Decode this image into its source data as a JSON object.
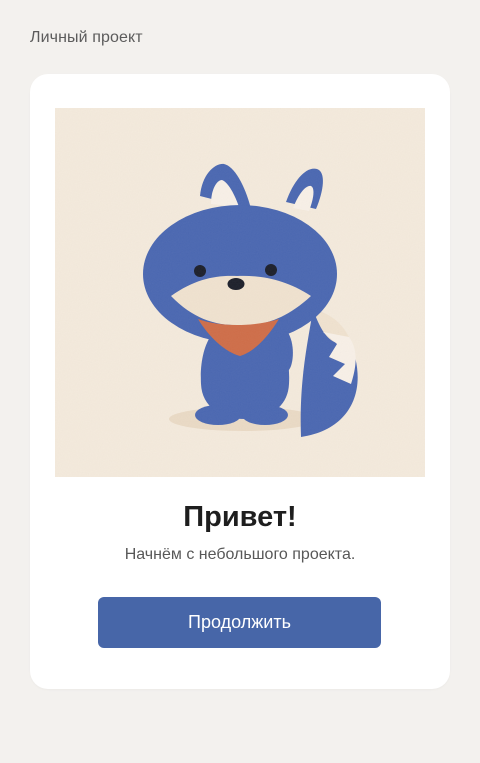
{
  "header": {
    "project_label": "Личный проект"
  },
  "card": {
    "title": "Привет!",
    "subtitle": "Начнём с небольшого проекта.",
    "continue_label": "Продолжить"
  },
  "illustration": {
    "subject": "fox-mascot",
    "colors": {
      "background": "#f4eadc",
      "fur": "#4a67b1",
      "muzzle": "#f0e2cf",
      "scarf": "#cf6d48"
    }
  },
  "colors": {
    "page_background": "#f3f1ee",
    "card_background": "#ffffff",
    "primary_button": "#4766a8"
  }
}
